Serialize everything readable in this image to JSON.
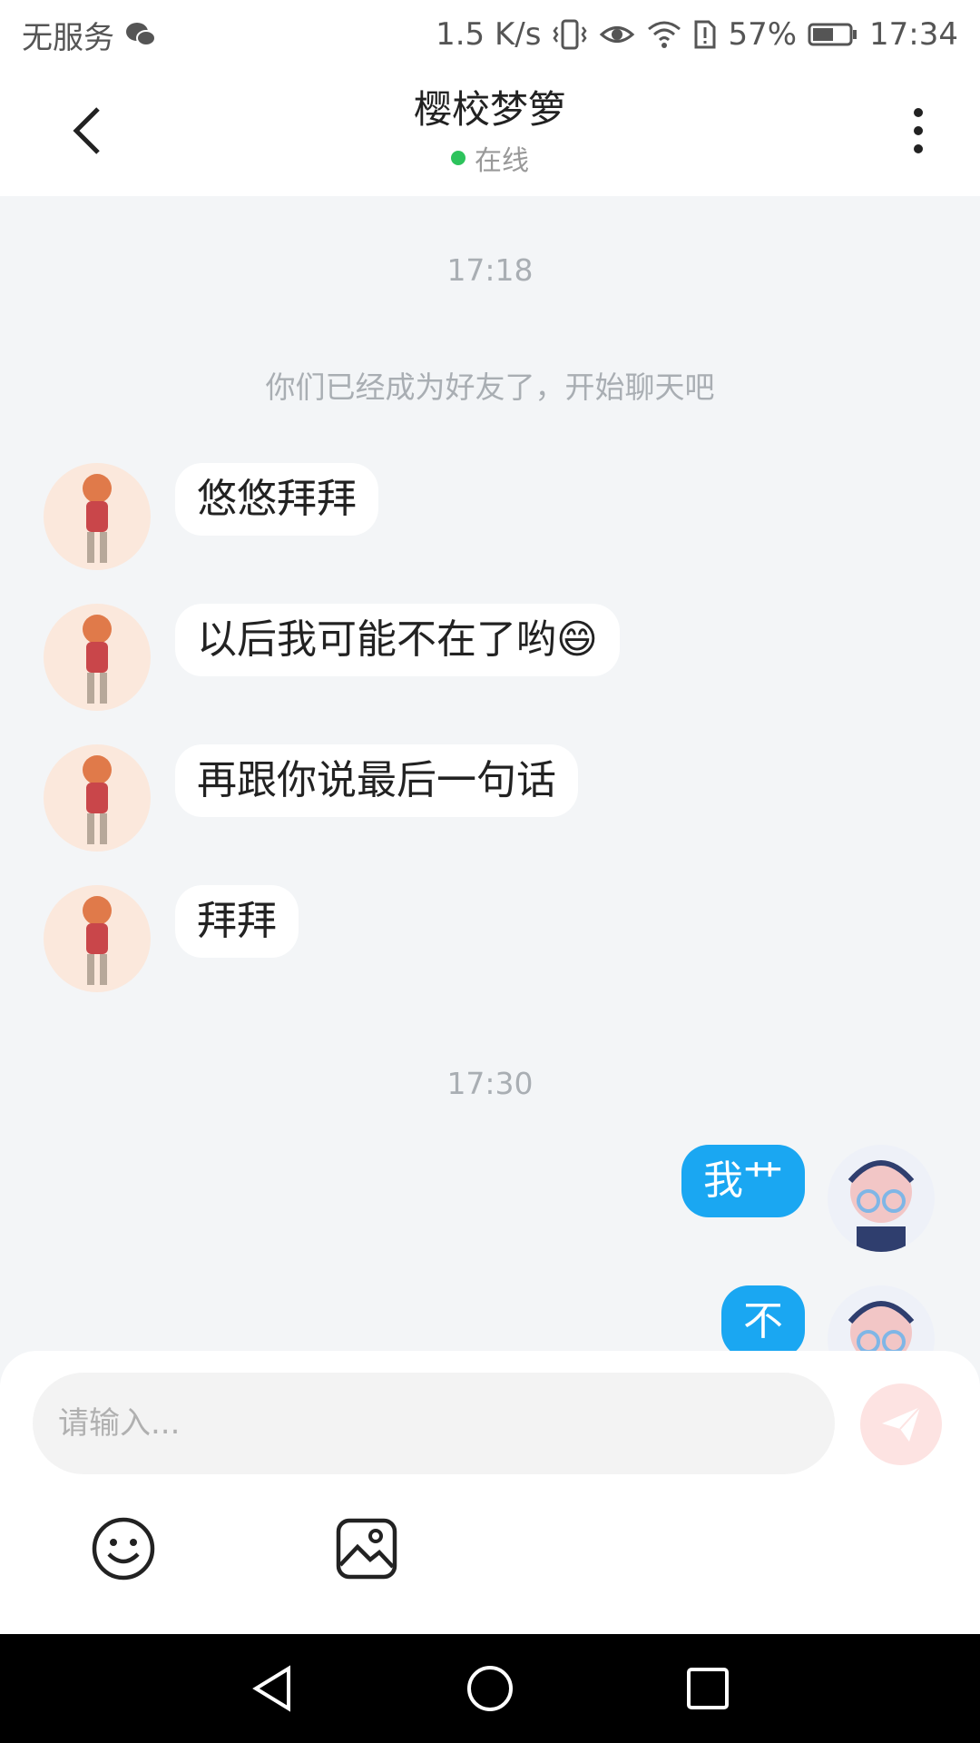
{
  "status_bar": {
    "carrier": "无服务",
    "speed": "1.5 K/s",
    "battery": "57%",
    "time": "17:34",
    "icons": [
      "wechat-icon",
      "vibrate-icon",
      "eye-icon",
      "wifi-icon",
      "sim-alert-icon",
      "battery-icon"
    ]
  },
  "header": {
    "title": "樱校梦箩",
    "status": "在线",
    "status_color": "#2dc35c"
  },
  "chat": {
    "timestamp_1": "17:18",
    "system_message": "你们已经成为好友了，开始聊天吧",
    "messages_in": [
      {
        "text": "悠悠拜拜"
      },
      {
        "text": "以后我可能不在了哟😄"
      },
      {
        "text": "再跟你说最后一句话"
      },
      {
        "text": "拜拜"
      }
    ],
    "timestamp_2": "17:30",
    "messages_out": [
      {
        "text": "我艹"
      },
      {
        "text": "不"
      }
    ]
  },
  "input": {
    "placeholder": "请输入..."
  },
  "colors": {
    "accent_blue": "#1aa7f2",
    "send_button": "#fde3e2",
    "background": "#f3f5f7"
  }
}
